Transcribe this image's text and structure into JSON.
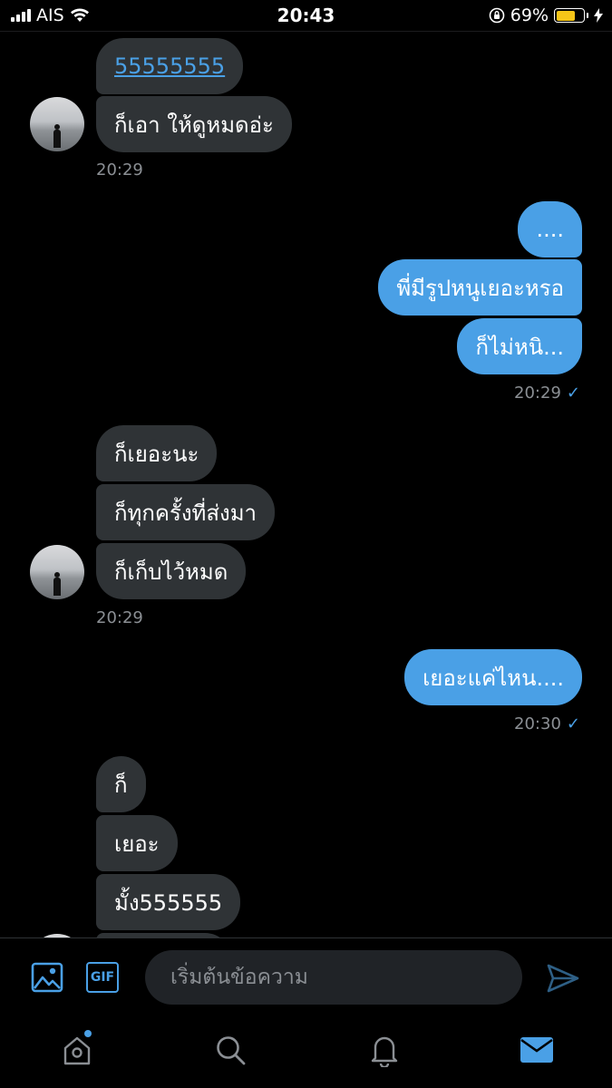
{
  "status_bar": {
    "carrier": "AIS",
    "time": "20:43",
    "battery_percent": "69%",
    "battery_level": 0.69,
    "icons": [
      "signal-icon",
      "wifi-icon",
      "orientation-lock-icon",
      "battery-icon",
      "charging-icon"
    ]
  },
  "messages": {
    "g1": {
      "b1": "55555555",
      "b2": "ก็เอา ให้ดูหมดอ่ะ",
      "time": "20:29"
    },
    "g2": {
      "b1": "....",
      "b2": "พี่มีรูปหนูเยอะหรอ",
      "b3": "ก็ไม่หนิ...",
      "time": "20:29"
    },
    "g3": {
      "b1": "ก็เยอะนะ",
      "b2": "ก็ทุกครั้งที่ส่งมา",
      "b3": "ก็เก็บไว้หมด",
      "time": "20:29"
    },
    "g4": {
      "b1": "เยอะแค่ไหน....",
      "time": "20:30"
    },
    "g5": {
      "b1": "ก็",
      "b2": "เยอะ",
      "b3": "มั้ง555555"
    },
    "read_check": "✓"
  },
  "composer": {
    "placeholder": "เริ่มต้นข้อความ",
    "gif_label": "GIF",
    "icons": [
      "image-icon",
      "gif-icon",
      "send-icon"
    ]
  },
  "tabbar": {
    "icons": [
      "home-icon",
      "search-icon",
      "notifications-icon",
      "messages-icon"
    ],
    "active": "messages"
  },
  "colors": {
    "background": "#000000",
    "incoming_bubble": "#2f3336",
    "outgoing_bubble": "#4aa0e6",
    "accent": "#4aa0e6",
    "timestamp": "#8b8f94"
  }
}
